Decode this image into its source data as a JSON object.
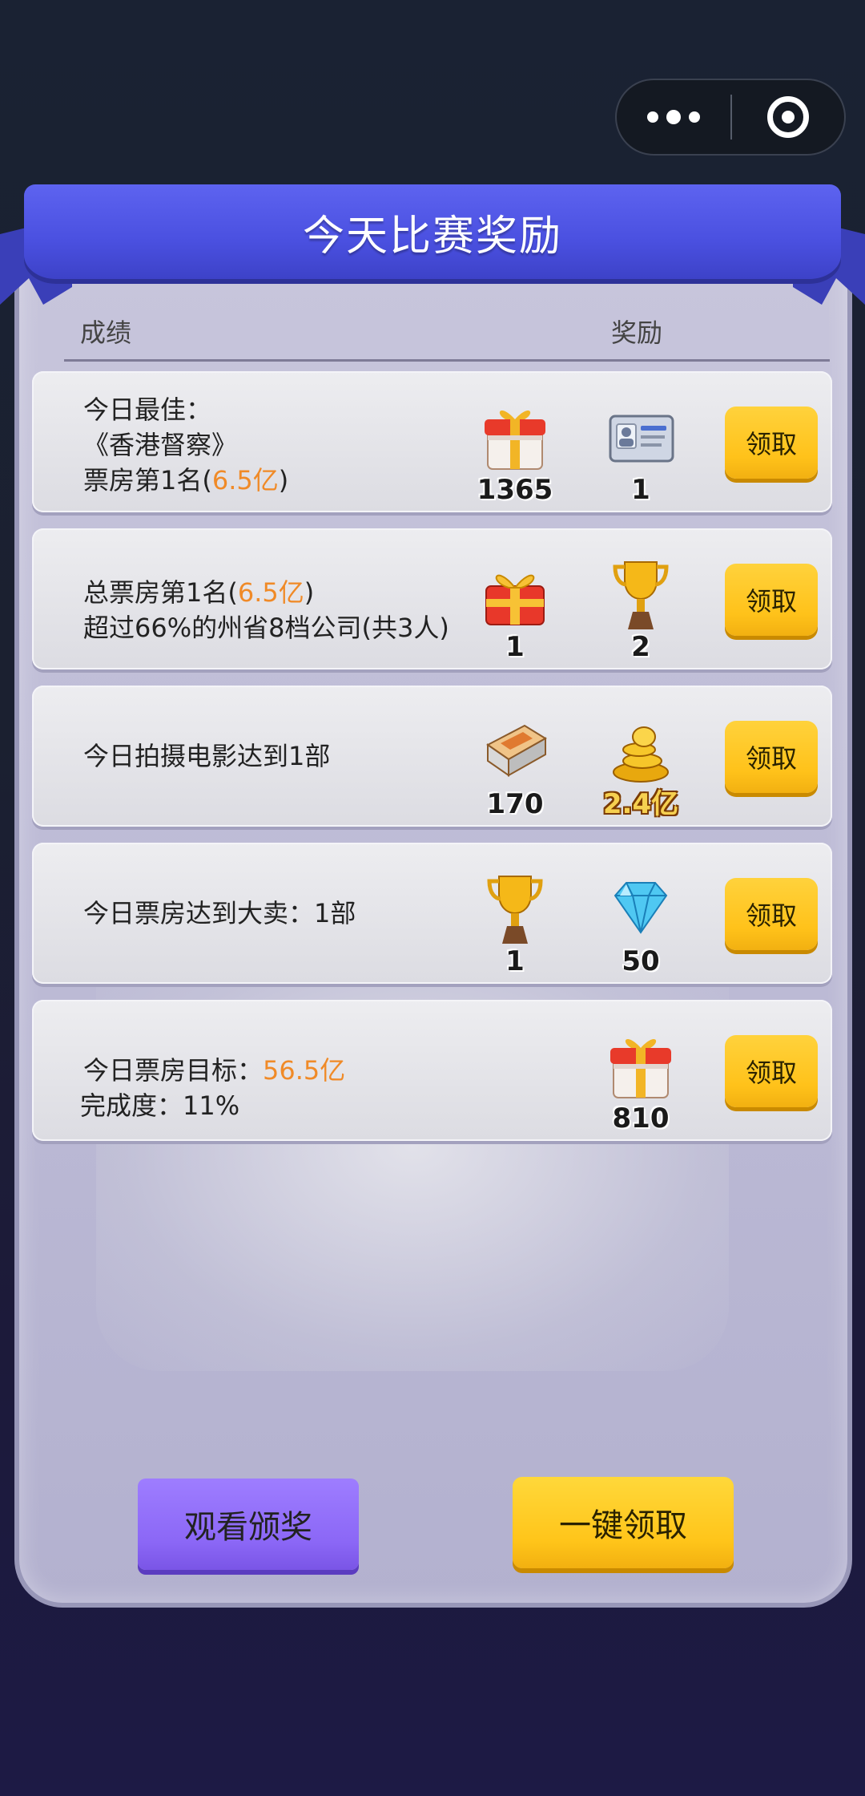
{
  "title": "今天比赛奖励",
  "headers": {
    "score": "成绩",
    "reward": "奖励"
  },
  "rows": [
    {
      "lines": [
        "今日最佳：",
        "《香港督察》",
        "票房第1名("
      ],
      "highlight": "6.5亿",
      "after_highlight": ")",
      "rewards": [
        {
          "icon": "gift-box-icon",
          "value": "1365"
        },
        {
          "icon": "id-card-icon",
          "value": "1"
        }
      ],
      "button": "领取"
    },
    {
      "lines": [
        "总票房第1名(",
        "超过66%的州省8档公司(共3人)"
      ],
      "highlight": "6.5亿",
      "after_highlight": ")",
      "rewards": [
        {
          "icon": "gift-bow-icon",
          "value": "1"
        },
        {
          "icon": "trophy-icon",
          "value": "2"
        }
      ],
      "button": "领取"
    },
    {
      "lines": [
        "今日拍摄电影达到1部"
      ],
      "rewards": [
        {
          "icon": "script-book-icon",
          "value": "170"
        },
        {
          "icon": "gold-coins-icon",
          "value": "2.4亿"
        }
      ],
      "button": "领取"
    },
    {
      "lines": [
        "今日票房达到大卖：1部"
      ],
      "rewards": [
        {
          "icon": "trophy-icon",
          "value": "1"
        },
        {
          "icon": "diamond-icon",
          "value": "50"
        }
      ],
      "button": "领取"
    },
    {
      "lines": [
        "今日票房目标：",
        "完成度：11%"
      ],
      "highlight": "56.5亿",
      "rewards": [
        {
          "icon": "gift-box-icon",
          "value": "810"
        }
      ],
      "button": "领取"
    }
  ],
  "buttons": {
    "watch": "观看颁奖",
    "claim_all": "一键领取"
  },
  "colors": {
    "highlight": "#f08a27",
    "claim": "#ffc21a",
    "watch": "#8b67f6",
    "ribbon": "#4a50e0"
  }
}
